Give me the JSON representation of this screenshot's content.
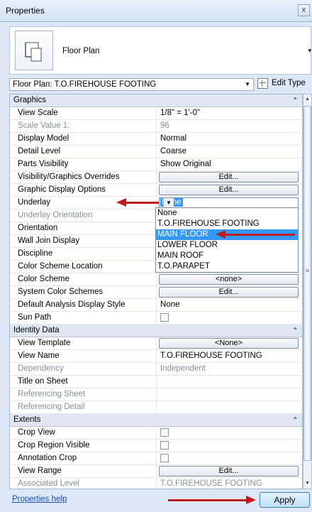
{
  "window": {
    "title": "Properties",
    "close_glyph": "x"
  },
  "type_selector": {
    "name": "Floor Plan",
    "arrow": "▾"
  },
  "instance_selector": {
    "value": "Floor Plan: T.O.FIREHOUSE FOOTING",
    "arrow": "▼"
  },
  "edit_type": {
    "label": "Edit Type"
  },
  "categories": {
    "graphics": "Graphics",
    "identity": "Identity Data",
    "extents": "Extents",
    "chevron": "⌃"
  },
  "rows": {
    "view_scale": {
      "name": "View Scale",
      "value": "1/8\" = 1'-0\""
    },
    "scale_value": {
      "name": "Scale Value    1:",
      "value": "96"
    },
    "display_model": {
      "name": "Display Model",
      "value": "Normal"
    },
    "detail_level": {
      "name": "Detail Level",
      "value": "Coarse"
    },
    "parts_visibility": {
      "name": "Parts Visibility",
      "value": "Show Original"
    },
    "vg_overrides": {
      "name": "Visibility/Graphics Overrides",
      "value": "Edit..."
    },
    "graphic_display": {
      "name": "Graphic Display Options",
      "value": "Edit..."
    },
    "underlay": {
      "name": "Underlay",
      "value": "None"
    },
    "underlay_orientation": {
      "name": "Underlay Orientation"
    },
    "orientation": {
      "name": "Orientation"
    },
    "wall_join": {
      "name": "Wall Join Display"
    },
    "discipline": {
      "name": "Discipline"
    },
    "color_scheme_location": {
      "name": "Color Scheme Location"
    },
    "color_scheme": {
      "name": "Color Scheme",
      "value": "<none>"
    },
    "system_color": {
      "name": "System Color Schemes",
      "value": "Edit..."
    },
    "default_analysis": {
      "name": "Default Analysis Display Style",
      "value": "None"
    },
    "sun_path": {
      "name": "Sun Path"
    },
    "view_template": {
      "name": "View Template",
      "value": "<None>"
    },
    "view_name": {
      "name": "View Name",
      "value": "T.O.FIREHOUSE FOOTING"
    },
    "dependency": {
      "name": "Dependency",
      "value": "Independent"
    },
    "title_on_sheet": {
      "name": "Title on Sheet"
    },
    "referencing_sheet": {
      "name": "Referencing Sheet"
    },
    "referencing_detail": {
      "name": "Referencing Detail"
    },
    "crop_view": {
      "name": "Crop View"
    },
    "crop_region": {
      "name": "Crop Region Visible"
    },
    "annotation_crop": {
      "name": "Annotation Crop"
    },
    "view_range": {
      "name": "View Range",
      "value": "Edit..."
    },
    "associated_level": {
      "name": "Associated Level",
      "value": "T.O.FIREHOUSE FOOTING"
    }
  },
  "underlay_dropdown": {
    "options": [
      "None",
      "T.O.FIREHOUSE FOOTING",
      "MAIN FLOOR",
      "LOWER FLOOR",
      "MAIN ROOF",
      "T.O.PARAPET"
    ],
    "selected_index": 2,
    "highlight_color": "#3399ff"
  },
  "scrollbar": {
    "up": "▲",
    "down": "▼",
    "grip": "≡"
  },
  "footer": {
    "help_link": "Properties help",
    "apply_button": "Apply"
  },
  "colors": {
    "annotation_arrow": "#c11a1a",
    "category_bg": "#dfe7f2",
    "window_bg": "#dde8f6"
  }
}
